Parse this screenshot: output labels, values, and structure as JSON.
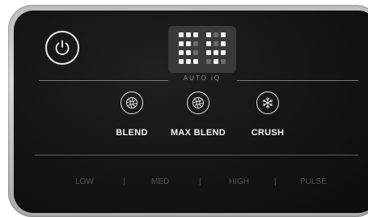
{
  "display": {
    "dots_left": [
      1,
      1,
      1,
      1,
      1,
      0,
      1,
      1,
      0,
      1,
      1,
      1
    ],
    "dots_right": [
      1,
      0,
      1,
      1,
      0,
      1,
      1,
      1,
      1,
      0,
      1,
      0
    ],
    "lit_color": "#f2f2f2",
    "dim_color": "#6b6b6b",
    "caption": "AUTO iQ"
  },
  "programs": [
    {
      "label": "BLEND",
      "icon": "blend-icon"
    },
    {
      "label": "MAX BLEND",
      "icon": "max-blend-icon"
    },
    {
      "label": "CRUSH",
      "icon": "snowflake-icon"
    }
  ],
  "speeds": [
    "LOW",
    "MED",
    "HIGH",
    "PULSE"
  ],
  "separator": "|",
  "colors": {
    "panel": "#141414",
    "bezel": "#bdbdbd",
    "text_active": "#f2f2f2",
    "text_inactive": "#555555"
  }
}
